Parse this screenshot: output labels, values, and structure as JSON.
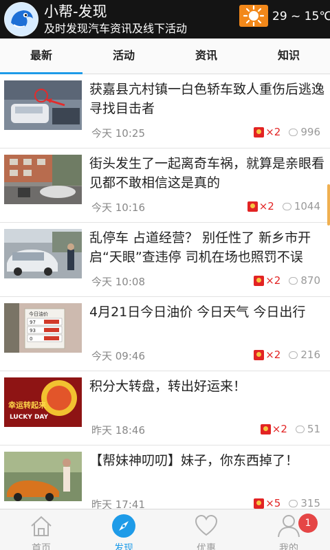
{
  "header": {
    "title": "小帮-发现",
    "subtitle": "及时发现汽车资讯及线下活动",
    "weather_icon": "sun-icon",
    "temperature": "29 ~ 15℃"
  },
  "tabs": [
    {
      "label": "最新",
      "active": true
    },
    {
      "label": "活动",
      "active": false
    },
    {
      "label": "资讯",
      "active": false
    },
    {
      "label": "知识",
      "active": false
    }
  ],
  "feed": [
    {
      "title": "获嘉县亢村镇一白色轿车致人重伤后逃逸 寻找目击者",
      "time": "今天 10:25",
      "redpacks": "×2",
      "comments": "996"
    },
    {
      "title": "街头发生了一起离奇车祸，就算是亲眼看见都不敢相信这是真的",
      "time": "今天 10:16",
      "redpacks": "×2",
      "comments": "1044"
    },
    {
      "title": "乱停车 占道经营？ 别任性了 新乡市开启“天眼”查违停 司机在场也照罚不误",
      "time": "今天 10:08",
      "redpacks": "×2",
      "comments": "870"
    },
    {
      "title": "4月21日今日油价 今日天气 今日出行",
      "time": "今天 09:46",
      "redpacks": "×2",
      "comments": "216",
      "thumb_text": {
        "title": "今日油价",
        "rows": [
          "97",
          "93",
          "0"
        ]
      }
    },
    {
      "title": "积分大转盘，转出好运来！",
      "time": "昨天 18:46",
      "redpacks": "×2",
      "comments": "51",
      "thumb_text": {
        "line1": "幸运转起来",
        "line2": "LUCKY DAY"
      }
    },
    {
      "title": "【帮妹神叨叨】妹子，你东西掉了！",
      "time": "昨天 17:41",
      "redpacks": "×5",
      "comments": "315"
    }
  ],
  "bottom_nav": [
    {
      "label": "首页",
      "icon": "home-icon",
      "active": false
    },
    {
      "label": "发现",
      "icon": "compass-icon",
      "active": true
    },
    {
      "label": "优惠",
      "icon": "heart-icon",
      "active": false
    },
    {
      "label": "我的",
      "icon": "user-icon",
      "active": false,
      "badge": "1"
    }
  ],
  "colors": {
    "accent": "#1e9be8",
    "header_bg": "#141414",
    "redpack": "#e22323",
    "badge": "#e54646",
    "weather": "#f2881a"
  }
}
